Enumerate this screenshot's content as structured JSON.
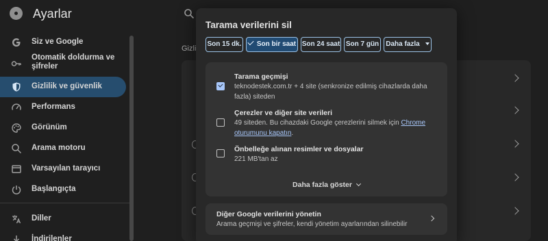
{
  "app": {
    "title": "Ayarlar",
    "logo_icon": "chrome-logo-icon"
  },
  "sidebar": {
    "items": [
      {
        "label": "Siz ve Google",
        "icon": "google-g-icon"
      },
      {
        "label": "Otomatik doldurma ve şifreler",
        "icon": "key-icon"
      },
      {
        "label": "Gizlilik ve güvenlik",
        "icon": "shield-icon",
        "active": true
      },
      {
        "label": "Performans",
        "icon": "speedometer-icon"
      },
      {
        "label": "Görünüm",
        "icon": "palette-icon"
      },
      {
        "label": "Arama motoru",
        "icon": "search-icon"
      },
      {
        "label": "Varsayılan tarayıcı",
        "icon": "browser-window-icon"
      },
      {
        "label": "Başlangıçta",
        "icon": "power-icon"
      },
      {
        "label": "Diller",
        "icon": "translate-icon"
      },
      {
        "label": "İndirilenler",
        "icon": "download-icon"
      }
    ]
  },
  "main": {
    "section_label": "Gizli"
  },
  "dialog": {
    "title": "Tarama verilerini sil",
    "time_ranges": [
      {
        "label": "Son 15 dk.",
        "selected": false
      },
      {
        "label": "Son bir saat",
        "selected": true
      },
      {
        "label": "Son 24 saat",
        "selected": false
      },
      {
        "label": "Son 7 gün",
        "selected": false
      },
      {
        "label": "Daha fazla",
        "selected": false
      }
    ],
    "options": [
      {
        "title": "Tarama geçmişi",
        "desc": "teknodestek.com.tr + 4 site (senkronize edilmiş cihazlarda daha fazla) siteden",
        "checked": true
      },
      {
        "title": "Çerezler ve diğer site verileri",
        "desc_prefix": "49 siteden. Bu cihazdaki Google çerezlerini silmek için ",
        "desc_link": "Chrome oturumunu kapatın",
        "desc_suffix": ".",
        "checked": false
      },
      {
        "title": "Önbelleğe alınan resimler ve dosyalar",
        "desc": "221 MB'tan az",
        "checked": false
      }
    ],
    "show_more_label": "Daha fazla göster",
    "google_data": {
      "title": "Diğer Google verilerini yönetin",
      "desc": "Arama geçmişi ve şifreler, kendi yönetim ayarlarından silinebilir"
    }
  },
  "colors": {
    "accent": "#a8c7fa",
    "chip_selected_bg": "#214b73",
    "sidebar_active_bg": "#264d6e",
    "dialog_bg": "#282828"
  }
}
